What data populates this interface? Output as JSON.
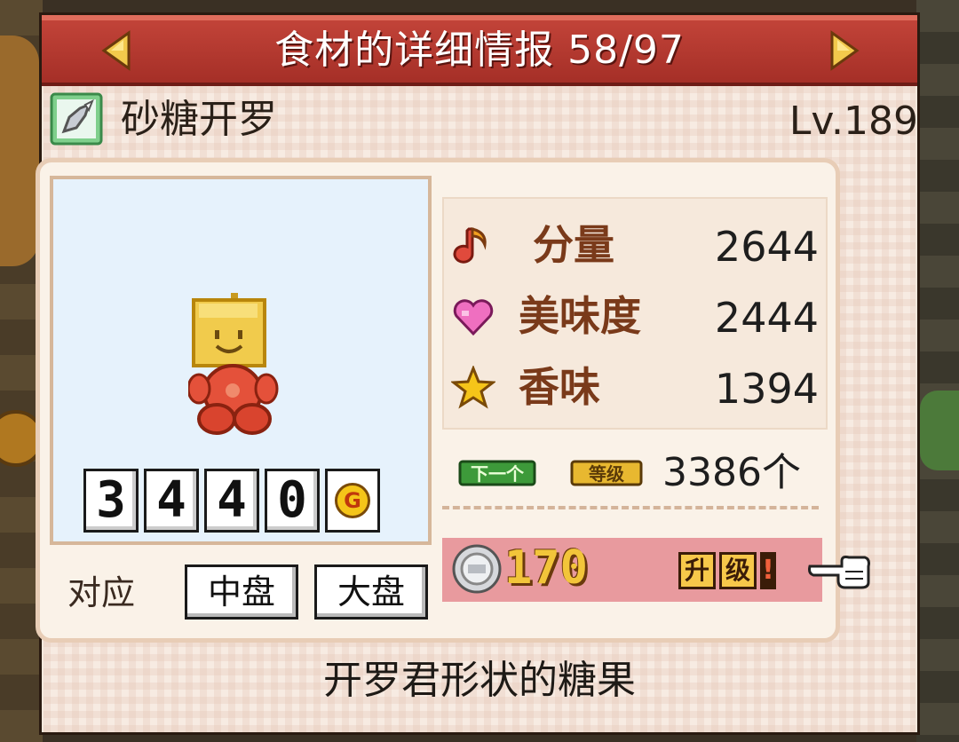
{
  "header": {
    "title": "食材的详细情报",
    "counter": "58/97",
    "prev_icon": "arrow-left-icon",
    "next_icon": "arrow-right-icon"
  },
  "ingredient": {
    "icon": "candy-wrapper-icon",
    "name": "砂糖开罗",
    "level": "Lv.189",
    "sell_price_digits": [
      "3",
      "4",
      "4",
      "0"
    ],
    "currency_symbol": "G",
    "description": "开罗君形状的糖果"
  },
  "stats": [
    {
      "icon": "music-note-icon",
      "label": "分量",
      "value": "2644"
    },
    {
      "icon": "heart-icon",
      "label": "美味度",
      "value": "2444"
    },
    {
      "icon": "star-icon",
      "label": "香味",
      "value": "1394"
    }
  ],
  "next_level": {
    "next_tag": "下一个",
    "grade_tag": "等级",
    "count": "3386个"
  },
  "upgrade": {
    "coin_icon": "silver-coin-icon",
    "cost": "170",
    "label_chars": [
      "升",
      "级"
    ],
    "bang": "!",
    "pointer_icon": "pointing-hand-icon"
  },
  "plates": {
    "label": "对应",
    "options": [
      "中盘",
      "大盘"
    ]
  },
  "colors": {
    "title_bar": "#b5362d",
    "panel_bg": "#faf2e8",
    "upgrade_bar": "#e89a9e",
    "stat_label": "#7a3a1a",
    "gold_text": "#f2c53a"
  }
}
